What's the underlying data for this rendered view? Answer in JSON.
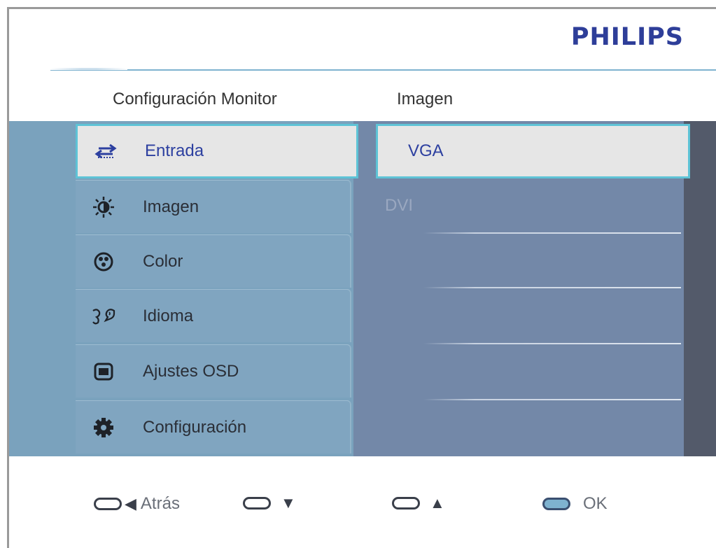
{
  "brand": "PHILIPS",
  "header": {
    "left": "Configuración Monitor",
    "right": "Imagen"
  },
  "menu": [
    {
      "label": "Entrada",
      "icon": "input-arrows-icon",
      "selected": true
    },
    {
      "label": "Imagen",
      "icon": "brightness-icon",
      "selected": false
    },
    {
      "label": "Color",
      "icon": "palette-icon",
      "selected": false
    },
    {
      "label": "Idioma",
      "icon": "language-icon",
      "selected": false
    },
    {
      "label": "Ajustes OSD",
      "icon": "osd-screen-icon",
      "selected": false
    },
    {
      "label": "Configuración",
      "icon": "gear-icon",
      "selected": false
    }
  ],
  "submenu": [
    {
      "label": "VGA",
      "selected": true
    },
    {
      "label": "DVI",
      "selected": false
    },
    {
      "label": "",
      "selected": false
    },
    {
      "label": "",
      "selected": false
    },
    {
      "label": "",
      "selected": false
    },
    {
      "label": "",
      "selected": false
    }
  ],
  "legend": {
    "back": {
      "glyph": "◀",
      "label": "Atrás"
    },
    "down": {
      "glyph": "▼"
    },
    "up": {
      "glyph": "▲"
    },
    "ok": {
      "label": "OK"
    }
  },
  "colors": {
    "brand": "#2e3e99",
    "selection_border": "#5ec3d6",
    "menu_bg": "#7aa2bd",
    "submenu_bg": "#7388a8",
    "selected_text": "#2d40a0"
  }
}
